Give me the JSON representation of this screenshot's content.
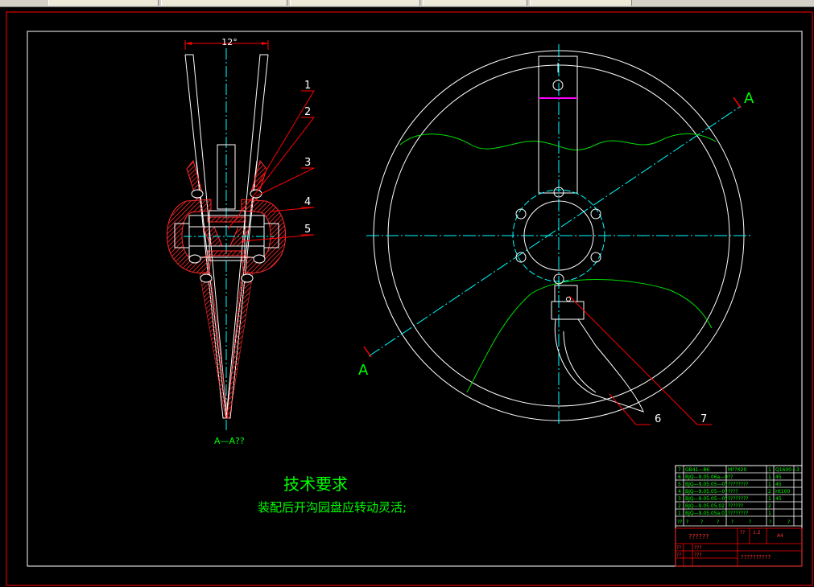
{
  "dimension": {
    "angle": "12°"
  },
  "callouts": [
    "1",
    "2",
    "3",
    "4",
    "5",
    "6",
    "7"
  ],
  "section_mark": "A",
  "section_view_label": "A—A??",
  "tech_title": "技术要求",
  "tech_note": "装配后开沟园盘应转动灵活;",
  "bom": {
    "rows": [
      {
        "no": "7",
        "code": "GB41—86",
        "name": "M??X20",
        "qty": "1",
        "mat": "Q1600—3"
      },
      {
        "no": "6",
        "code": "BJQ—9.05.06a—0??",
        "name": "",
        "qty": "1",
        "mat": "45"
      },
      {
        "no": "5",
        "code": "BJQ—9.05.05—0?",
        "name": "????????",
        "qty": "1",
        "mat": "45"
      },
      {
        "no": "4",
        "code": "BJQ—9.05.05—0?",
        "name": "????",
        "qty": "2",
        "mat": "Ht100"
      },
      {
        "no": "3",
        "code": "BJQ—9.05.05—0?",
        "name": "????????",
        "qty": "1",
        "mat": "45"
      },
      {
        "no": "2",
        "code": "BJQ—9.05.05.02",
        "name": "??????",
        "qty": "2",
        "mat": ""
      },
      {
        "no": "1",
        "code": "BJQ—9.05.05a.01",
        "name": "????????",
        "qty": "1",
        "mat": ""
      }
    ],
    "header": [
      "??",
      "?",
      "?",
      "?",
      "?",
      "?",
      "?",
      "?"
    ],
    "drawing_title": "??????",
    "scale_label": "??",
    "scale_value": "1:2",
    "size_label": "A4",
    "designer_label": "??",
    "designer": "???",
    "checker_label": "??",
    "checker": "???",
    "company": "??????????"
  },
  "colors": {
    "frame": "#ff0000",
    "outline": "#ffffff",
    "centerline": "#00ffff",
    "hatch": "#ff2a2a",
    "leader": "#ff0000",
    "text": "#00ff00",
    "soil": "#00e000",
    "bolt": "#ff00ff",
    "titleblock": "#ffffff",
    "titleblock_red": "#ff0000"
  }
}
